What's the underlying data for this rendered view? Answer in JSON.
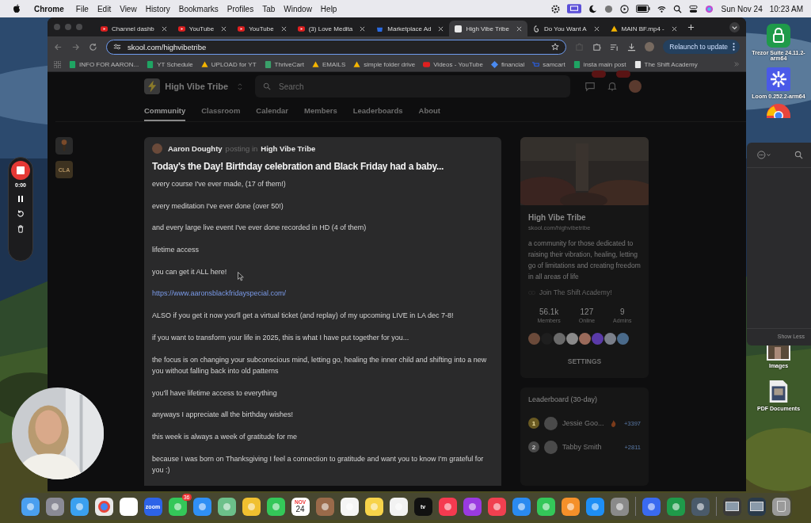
{
  "menubar": {
    "app": "Chrome",
    "menus": [
      "File",
      "Edit",
      "View",
      "History",
      "Bookmarks",
      "Profiles",
      "Tab",
      "Window",
      "Help"
    ],
    "date": "Sun Nov 24",
    "time": "10:23 AM"
  },
  "browser": {
    "tabs": [
      {
        "title": "Channel dashb",
        "kind": "youtube",
        "selected": false
      },
      {
        "title": "YouTube",
        "kind": "youtube",
        "selected": false
      },
      {
        "title": "YouTube",
        "kind": "youtube",
        "selected": false
      },
      {
        "title": "(3) Love Medita",
        "kind": "youtube",
        "selected": false
      },
      {
        "title": "Marketplace Ad",
        "kind": "marketplace",
        "selected": false
      },
      {
        "title": "High Vibe Tribe",
        "kind": "skool",
        "selected": true
      },
      {
        "title": "Do You Want A",
        "kind": "thread",
        "selected": false
      },
      {
        "title": "MAIN BF.mp4 -",
        "kind": "drive",
        "selected": false
      }
    ],
    "address": "skool.com/highvibetribe",
    "relaunch": "Relaunch to update",
    "bookmarks": [
      {
        "label": "INFO FOR AARON...",
        "kind": "sheets"
      },
      {
        "label": "YT Schedule",
        "kind": "sheets"
      },
      {
        "label": "UPLOAD for YT",
        "kind": "drive"
      },
      {
        "label": "ThriveCart",
        "kind": "thrive"
      },
      {
        "label": "EMAILS",
        "kind": "drive"
      },
      {
        "label": "simple folder drive",
        "kind": "drive"
      },
      {
        "label": "Videos - YouTube",
        "kind": "youtube"
      },
      {
        "label": "financial",
        "kind": "financial"
      },
      {
        "label": "samcart",
        "kind": "samcart"
      },
      {
        "label": "insta main post",
        "kind": "sheets"
      },
      {
        "label": "The Shift Academy",
        "kind": "skool"
      }
    ]
  },
  "group_header": {
    "name": "High Vibe Tribe",
    "search": {
      "placeholder": "Search"
    },
    "nav": [
      {
        "label": "Community",
        "selected": true
      },
      {
        "label": "Classroom",
        "selected": false
      },
      {
        "label": "Calendar",
        "selected": false
      },
      {
        "label": "Members",
        "selected": false
      },
      {
        "label": "Leaderboards",
        "selected": false
      },
      {
        "label": "About",
        "selected": false
      }
    ]
  },
  "group_switcher": [
    {
      "kind": "logo"
    },
    {
      "kind": "text",
      "label": "CLA"
    }
  ],
  "post": {
    "author": "Aaron Doughty",
    "posting_in": "posting in",
    "group": "High Vibe Tribe",
    "title": "Today's the Day! Birthday celebration and Black Friday had a baby...",
    "paragraphs": [
      {
        "kind": "text",
        "text": "every course I've ever made, (17 of them!)"
      },
      {
        "kind": "text",
        "text": "every meditation I've ever done (over 50!)"
      },
      {
        "kind": "text",
        "text": "and every large live event I've ever done recorded in HD (4 of them)"
      },
      {
        "kind": "text",
        "text": "lifetime access"
      },
      {
        "kind": "text",
        "text": "you can get it ALL here!"
      },
      {
        "kind": "link",
        "text": "https://www.aaronsblackfridayspecial.com/"
      },
      {
        "kind": "text",
        "text": "ALSO if you get it now you'll get a virtual ticket (and replay) of my upcoming LIVE in LA dec 7-8!"
      },
      {
        "kind": "text",
        "text": "if you want to transform your life in 2025, this is what I have put together for you..."
      },
      {
        "kind": "text",
        "text": "the focus is on changing your subconscious mind, letting go, healing the inner child and shifting into a new you without falling back into old patterns"
      },
      {
        "kind": "text",
        "text": "you'll have lifetime access to everything"
      },
      {
        "kind": "text",
        "text": "anyways I appreciate all the birthday wishes!"
      },
      {
        "kind": "text",
        "text": "this week is always a week of gratitude for me"
      },
      {
        "kind": "text",
        "text": "because I was born on Thanksgiving I feel a connection to gratitude and want you to know I'm grateful for you :)"
      }
    ]
  },
  "about_card": {
    "name": "High Vibe Tribe",
    "url": "skool.com/highvibetribe",
    "description": "a community for those dedicated to raising their vibration, healing, letting go of limitations and creating freedom in all areas of life",
    "link": "Join The Shift Academy!",
    "stats": [
      {
        "value": "56.1k",
        "label": "Members"
      },
      {
        "value": "127",
        "label": "Online"
      },
      {
        "value": "9",
        "label": "Admins"
      }
    ],
    "member_avatars": [
      {
        "color": "#6b4a3a"
      },
      {
        "color": "#1e1e1e"
      },
      {
        "color": "#6a6a6a"
      },
      {
        "color": "#8a8a8a"
      },
      {
        "color": "#9a6a5a"
      },
      {
        "color": "#5a3aa8"
      },
      {
        "color": "#7a7f8a"
      },
      {
        "color": "#4a6a8a"
      }
    ],
    "settings": "SETTINGS"
  },
  "leaderboard": {
    "title": "Leaderboard (30-day)",
    "rows": [
      {
        "rank": "1",
        "name": "Jessie Goo...",
        "points": "+3397",
        "streak": true
      },
      {
        "rank": "2",
        "name": "Tabby Smith",
        "points": "+2811",
        "streak": false
      }
    ]
  },
  "recorder": {
    "time": "0:00"
  },
  "finder_panel": {
    "button": "Show Less"
  },
  "desktop_items": [
    {
      "kind": "trezor",
      "label": "Trezor Suite 24.11.2-arm64"
    },
    {
      "kind": "loom",
      "label": "Loom 0.252.2-arm64"
    },
    {
      "kind": "chrome"
    },
    {
      "kind": "images",
      "label": "Images"
    },
    {
      "kind": "pdf",
      "label": "PDF Documents"
    }
  ],
  "dock": {
    "apps": [
      {
        "kind": "app",
        "color": "#4a9ff0"
      },
      {
        "kind": "app",
        "color": "#8a8a96"
      },
      {
        "kind": "app",
        "color": "#3aa0f0"
      },
      {
        "kind": "chrome",
        "color": "#e8e8e8"
      },
      {
        "kind": "app",
        "color": "#ffffff"
      },
      {
        "kind": "label",
        "color": "#2d63e8",
        "label": "zoom"
      },
      {
        "kind": "badge",
        "color": "#34c759",
        "badge": "36"
      },
      {
        "kind": "app",
        "color": "#2f8ff5"
      },
      {
        "kind": "app",
        "color": "#6cc08a"
      },
      {
        "kind": "app",
        "color": "#f0c030"
      },
      {
        "kind": "app",
        "color": "#34c759"
      },
      {
        "kind": "calendar",
        "color": "#ffffff",
        "month": "NOV",
        "day": "24"
      },
      {
        "kind": "app",
        "color": "#9a6a4a"
      },
      {
        "kind": "app",
        "color": "#f5f5f5"
      },
      {
        "kind": "app",
        "color": "#f7d34a"
      },
      {
        "kind": "app",
        "color": "#f2f2f2"
      },
      {
        "kind": "label",
        "color": "#111111",
        "label": "tv"
      },
      {
        "kind": "app",
        "color": "#f53a50"
      },
      {
        "kind": "app",
        "color": "#9a3ae0"
      },
      {
        "kind": "app",
        "color": "#f04050"
      },
      {
        "kind": "app",
        "color": "#2a8af0"
      },
      {
        "kind": "app",
        "color": "#34c759"
      },
      {
        "kind": "app",
        "color": "#f5902a"
      },
      {
        "kind": "app",
        "color": "#1e8ef5"
      },
      {
        "kind": "app",
        "color": "#8a8a8a"
      }
    ],
    "utilities": [
      {
        "kind": "app",
        "color": "#3a6af0"
      },
      {
        "kind": "app",
        "color": "#1f9a4a"
      },
      {
        "kind": "app",
        "color": "#4a5a6a"
      }
    ],
    "stacks": [
      {
        "kind": "stack",
        "color": "#3a3a3a"
      },
      {
        "kind": "stack",
        "color": "#2a3a4a"
      },
      {
        "kind": "trash",
        "color": "#9a9a9a"
      }
    ]
  }
}
